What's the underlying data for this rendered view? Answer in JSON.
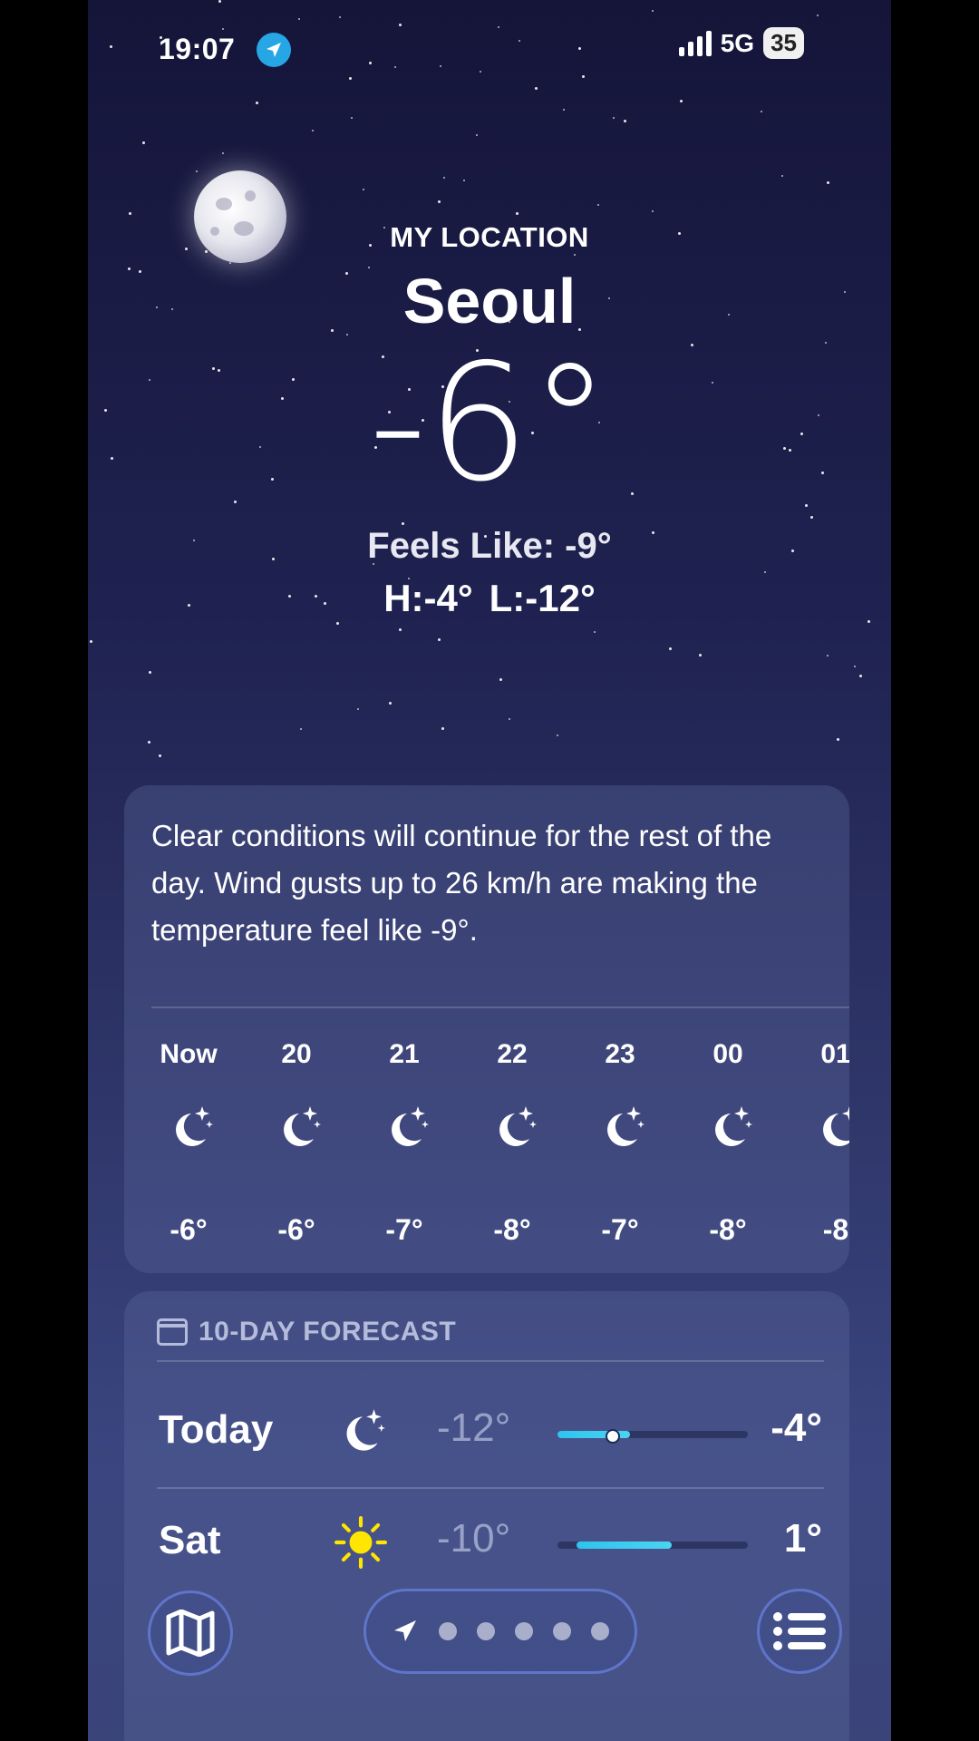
{
  "status_bar": {
    "time": "19:07",
    "network": "5G",
    "battery": "35"
  },
  "header": {
    "label": "MY LOCATION",
    "city": "Seoul",
    "temperature": "-6°",
    "feels_like": "Feels Like: -9°",
    "high": "H:-4°",
    "low": "L:-12°"
  },
  "summary": "Clear conditions will continue for the rest of the day. Wind gusts up to 26 km/h are making the temperature feel like -9°.",
  "hourly": [
    {
      "label": "Now",
      "icon": "moon-stars-icon",
      "temp": "-6°"
    },
    {
      "label": "20",
      "icon": "moon-stars-icon",
      "temp": "-6°"
    },
    {
      "label": "21",
      "icon": "moon-stars-icon",
      "temp": "-7°"
    },
    {
      "label": "22",
      "icon": "moon-stars-icon",
      "temp": "-8°"
    },
    {
      "label": "23",
      "icon": "moon-stars-icon",
      "temp": "-7°"
    },
    {
      "label": "00",
      "icon": "moon-stars-icon",
      "temp": "-8°"
    },
    {
      "label": "01",
      "icon": "moon-stars-icon",
      "temp": "-8"
    }
  ],
  "forecast": {
    "title": "10-DAY FORECAST",
    "days": [
      {
        "day": "Today",
        "icon": "moon-stars-icon",
        "low": "-12°",
        "high": "-4°",
        "range_start": 0.0,
        "range_end": 0.38,
        "current_marker": 0.28
      },
      {
        "day": "Sat",
        "icon": "sun-icon",
        "low": "-10°",
        "high": "1°",
        "range_start": 0.1,
        "range_end": 0.6
      }
    ]
  },
  "toolbar": {
    "map_icon": "map-icon",
    "location_icon": "location-arrow-icon",
    "list_icon": "list-icon",
    "page_dots": 5
  },
  "colors": {
    "accent": "#2ec4ee",
    "sun": "#ffe600",
    "location_badge": "#27a6e6"
  }
}
